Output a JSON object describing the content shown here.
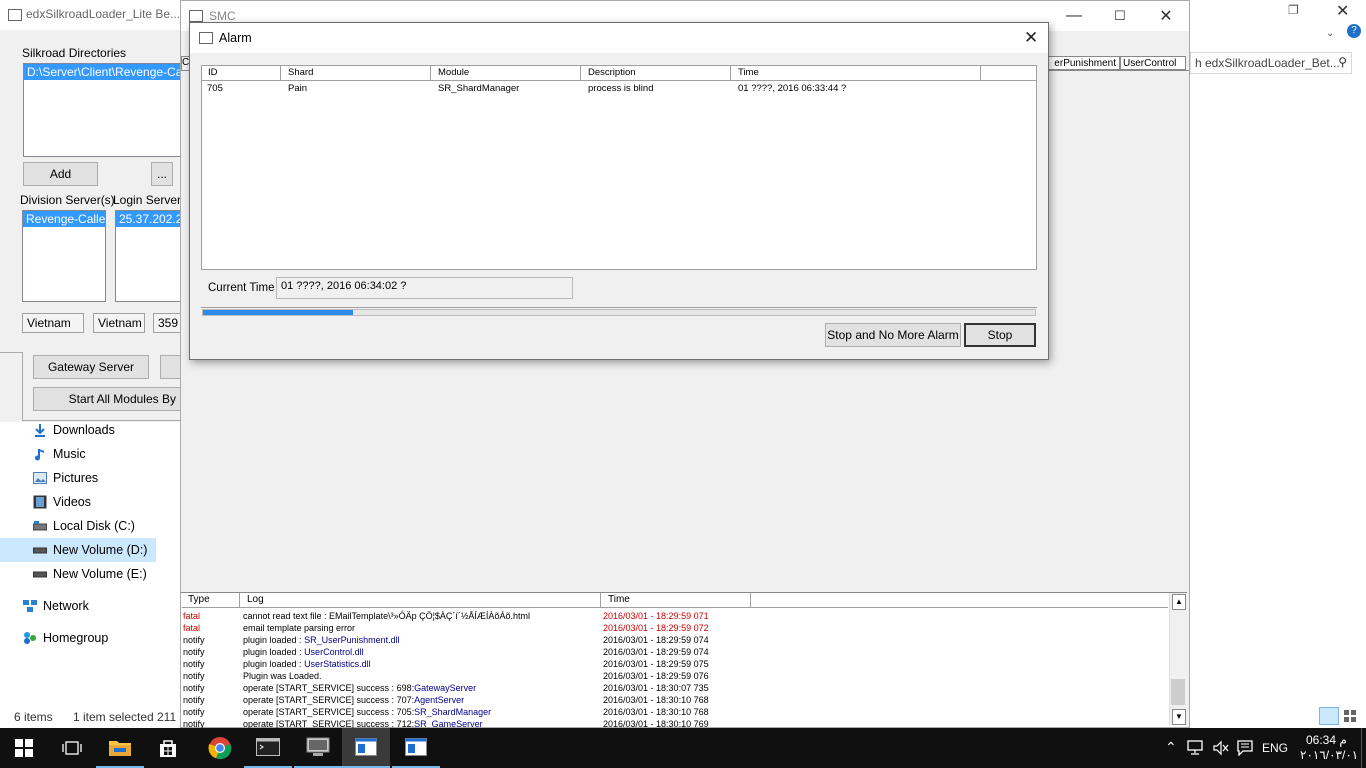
{
  "explorer": {
    "search_placeholder": "h edxSilkroadLoader_Bet...",
    "nav": [
      {
        "label": "Downloads",
        "icon": "download-icon"
      },
      {
        "label": "Music",
        "icon": "music-icon"
      },
      {
        "label": "Pictures",
        "icon": "pictures-icon"
      },
      {
        "label": "Videos",
        "icon": "videos-icon"
      },
      {
        "label": "Local Disk (C:)",
        "icon": "drive-icon"
      },
      {
        "label": "New Volume (D:)",
        "icon": "drive-icon"
      },
      {
        "label": "New Volume (E:)",
        "icon": "drive-icon"
      },
      {
        "label": "Network",
        "icon": "network-icon"
      },
      {
        "label": "Homegroup",
        "icon": "homegroup-icon"
      }
    ],
    "status": {
      "items": "6 items",
      "selected": "1 item selected",
      "size": "211"
    }
  },
  "loader": {
    "title": "edxSilkroadLoader_Lite Be...",
    "dirs_label": "Silkroad Directories",
    "dir_item": "D:\\Server\\Client\\Revenge-Callen",
    "add_label": "Add",
    "browse_label": "...",
    "division_label": "Division Server(s)",
    "login_label": "Login Server(s",
    "division_item": "Revenge-Callenc",
    "login_item": "25.37.202.2",
    "field1": "Vietnam",
    "field2": "Vietnam",
    "field3": "359",
    "gateway_label": "Gateway Server",
    "start_all_label": "Start All Modules By"
  },
  "smc": {
    "title": "SMC",
    "tab_punishment": "erPunishment",
    "tab_usercontrol": "UserControl",
    "tab_partial": "C",
    "log_headers": [
      "Type",
      "Log",
      "Time"
    ],
    "log_rows": [
      {
        "type": "fatal",
        "log": "cannot read text file : EMailTemplate\\³»ÓÄp ÇÖ¦$ÀÇ´í´½ÅÍÆÍÀõÁõ.html",
        "extra": "",
        "time": "2016/03/01 - 18:29:59 071",
        "level": "fatal"
      },
      {
        "type": "fatal",
        "log": "email template parsing error",
        "extra": "",
        "time": "2016/03/01 - 18:29:59 072",
        "level": "fatal"
      },
      {
        "type": "notify",
        "log": "plugin loaded : ",
        "extra": "SR_UserPunishment.dll",
        "time": "2016/03/01 - 18:29:59 074",
        "level": "notify"
      },
      {
        "type": "notify",
        "log": "plugin loaded : ",
        "extra": "UserControl.dll",
        "time": "2016/03/01 - 18:29:59 074",
        "level": "notify"
      },
      {
        "type": "notify",
        "log": "plugin loaded : ",
        "extra": "UserStatistics.dll",
        "time": "2016/03/01 - 18:29:59 075",
        "level": "notify"
      },
      {
        "type": "notify",
        "log": "Plugin was Loaded.",
        "extra": "",
        "time": "2016/03/01 - 18:29:59 076",
        "level": "notify"
      },
      {
        "type": "notify",
        "log": "operate [START_SERVICE] success : 698:",
        "extra": "GatewayServer",
        "time": "2016/03/01 - 18:30:07 735",
        "level": "notify"
      },
      {
        "type": "notify",
        "log": "operate [START_SERVICE] success : 707:",
        "extra": "AgentServer",
        "time": "2016/03/01 - 18:30:10 768",
        "level": "notify"
      },
      {
        "type": "notify",
        "log": "operate [START_SERVICE] success : 705:",
        "extra": "SR_ShardManager",
        "time": "2016/03/01 - 18:30:10 768",
        "level": "notify"
      },
      {
        "type": "notify",
        "log": "operate [START_SERVICE] success : 712:",
        "extra": "SR_GameServer",
        "time": "2016/03/01 - 18:30:10 769",
        "level": "notify"
      }
    ]
  },
  "alarm": {
    "title": "Alarm",
    "headers": [
      "ID",
      "Shard",
      "Module",
      "Description",
      "Time"
    ],
    "rows": [
      {
        "id": "705",
        "shard": "Pain",
        "module": "SR_ShardManager",
        "description": "process is blind",
        "time": "01 ????, 2016 06:33:44 ?"
      }
    ],
    "current_time_label": "Current Time",
    "current_time_value": "01 ????, 2016 06:34:02 ?",
    "progress": 0.18,
    "stop_no_more_label": "Stop and No More Alarm",
    "stop_label": "Stop"
  },
  "taskbar": {
    "language": "ENG",
    "time": "06:34 م",
    "date": "٢٠١٦/٠٣/٠١"
  },
  "colors": {
    "accent": "#0078d7",
    "selection": "#3399ff",
    "fatal": "#cc0000",
    "link": "#00008b",
    "taskbar": "#101010"
  }
}
